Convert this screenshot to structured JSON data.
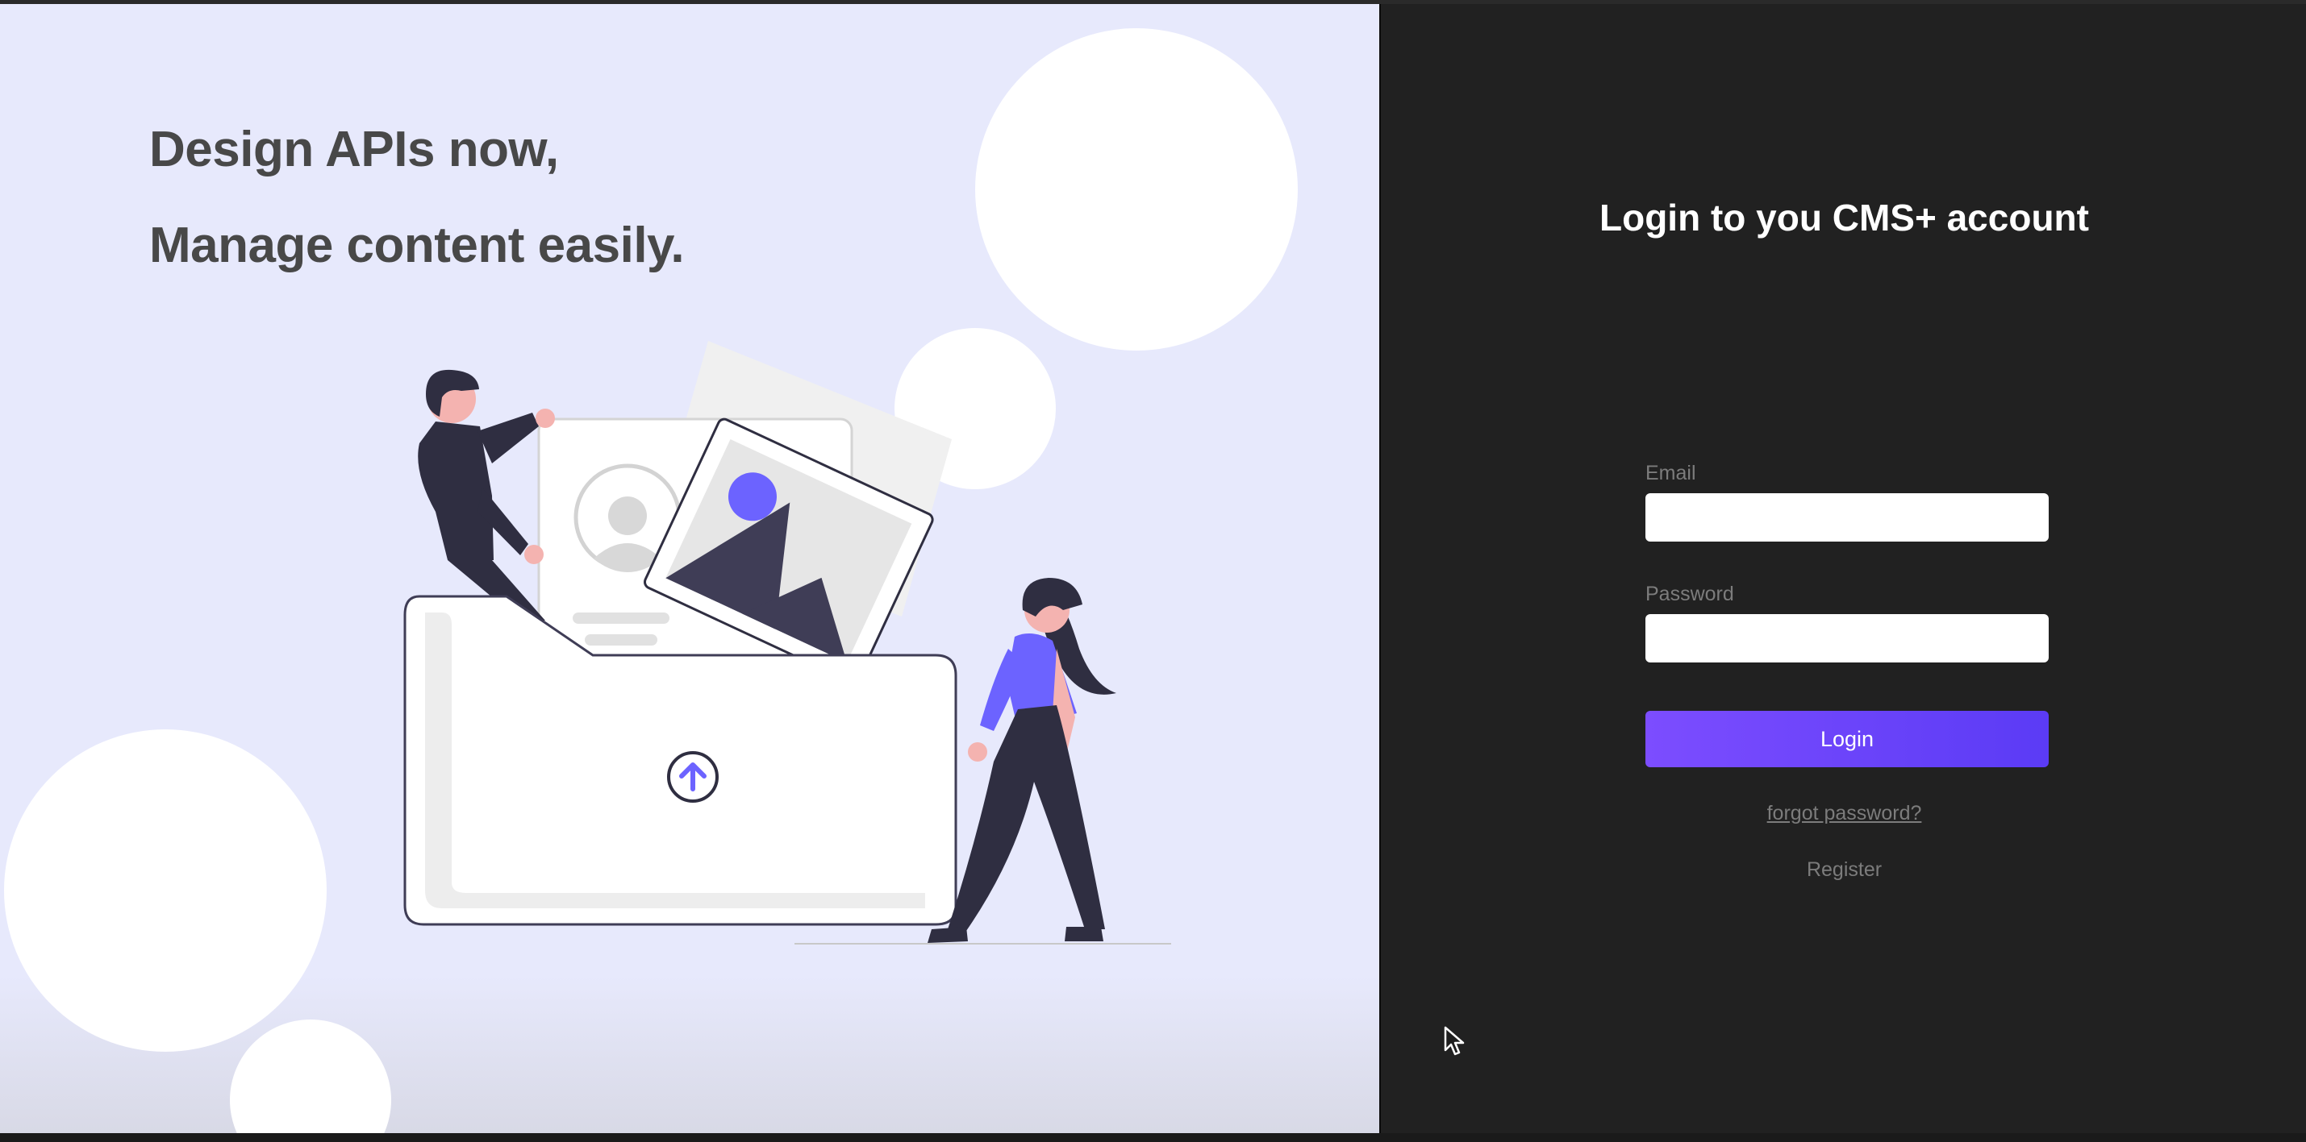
{
  "hero": {
    "headline_line1": "Design APIs now,",
    "headline_line2": "Manage content easily."
  },
  "login": {
    "title": "Login to you CMS+ account",
    "email_label": "Email",
    "email_value": "",
    "password_label": "Password",
    "password_value": "",
    "login_button": "Login",
    "forgot_password": "forgot password?",
    "register": "Register"
  },
  "colors": {
    "hero_background": "#e7e9fc",
    "panel_background": "#212121",
    "accent": "#6c45f8",
    "illustration_dark": "#2f2e41",
    "illustration_accent": "#6c63ff",
    "skin": "#f4b3b0"
  },
  "icons": {
    "upload": "upload-arrow-icon",
    "cursor": "mouse-pointer-icon"
  }
}
